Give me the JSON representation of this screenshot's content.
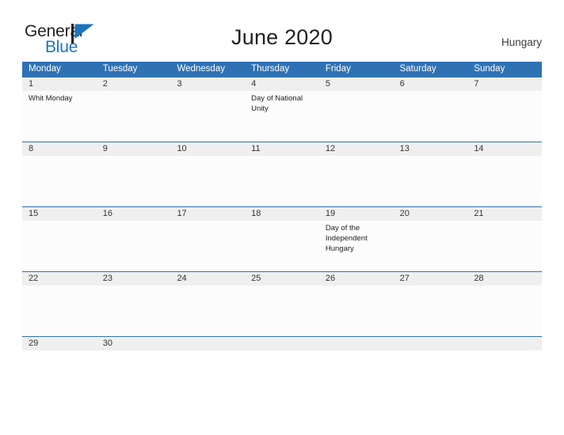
{
  "brand": {
    "word_one": "General",
    "word_two": "Blue",
    "flag_icon": "pennant-flag-icon",
    "color_dark": "#231f20",
    "color_blue": "#1b75bb"
  },
  "header": {
    "title": "June 2020",
    "country": "Hungary"
  },
  "calendar": {
    "accent_color": "#2f72b4",
    "date_strip_color": "#efefef",
    "weekdays": [
      "Monday",
      "Tuesday",
      "Wednesday",
      "Thursday",
      "Friday",
      "Saturday",
      "Sunday"
    ],
    "weeks": [
      {
        "days": [
          {
            "date": "1",
            "event": "Whit Monday"
          },
          {
            "date": "2",
            "event": ""
          },
          {
            "date": "3",
            "event": ""
          },
          {
            "date": "4",
            "event": "Day of National Unity"
          },
          {
            "date": "5",
            "event": ""
          },
          {
            "date": "6",
            "event": ""
          },
          {
            "date": "7",
            "event": ""
          }
        ]
      },
      {
        "days": [
          {
            "date": "8",
            "event": ""
          },
          {
            "date": "9",
            "event": ""
          },
          {
            "date": "10",
            "event": ""
          },
          {
            "date": "11",
            "event": ""
          },
          {
            "date": "12",
            "event": ""
          },
          {
            "date": "13",
            "event": ""
          },
          {
            "date": "14",
            "event": ""
          }
        ]
      },
      {
        "days": [
          {
            "date": "15",
            "event": ""
          },
          {
            "date": "16",
            "event": ""
          },
          {
            "date": "17",
            "event": ""
          },
          {
            "date": "18",
            "event": ""
          },
          {
            "date": "19",
            "event": "Day of the Independent Hungary"
          },
          {
            "date": "20",
            "event": ""
          },
          {
            "date": "21",
            "event": ""
          }
        ]
      },
      {
        "days": [
          {
            "date": "22",
            "event": ""
          },
          {
            "date": "23",
            "event": ""
          },
          {
            "date": "24",
            "event": ""
          },
          {
            "date": "25",
            "event": ""
          },
          {
            "date": "26",
            "event": ""
          },
          {
            "date": "27",
            "event": ""
          },
          {
            "date": "28",
            "event": ""
          }
        ]
      },
      {
        "days": [
          {
            "date": "29",
            "event": ""
          },
          {
            "date": "30",
            "event": ""
          },
          {
            "date": "",
            "event": ""
          },
          {
            "date": "",
            "event": ""
          },
          {
            "date": "",
            "event": ""
          },
          {
            "date": "",
            "event": ""
          },
          {
            "date": "",
            "event": ""
          }
        ]
      }
    ]
  }
}
